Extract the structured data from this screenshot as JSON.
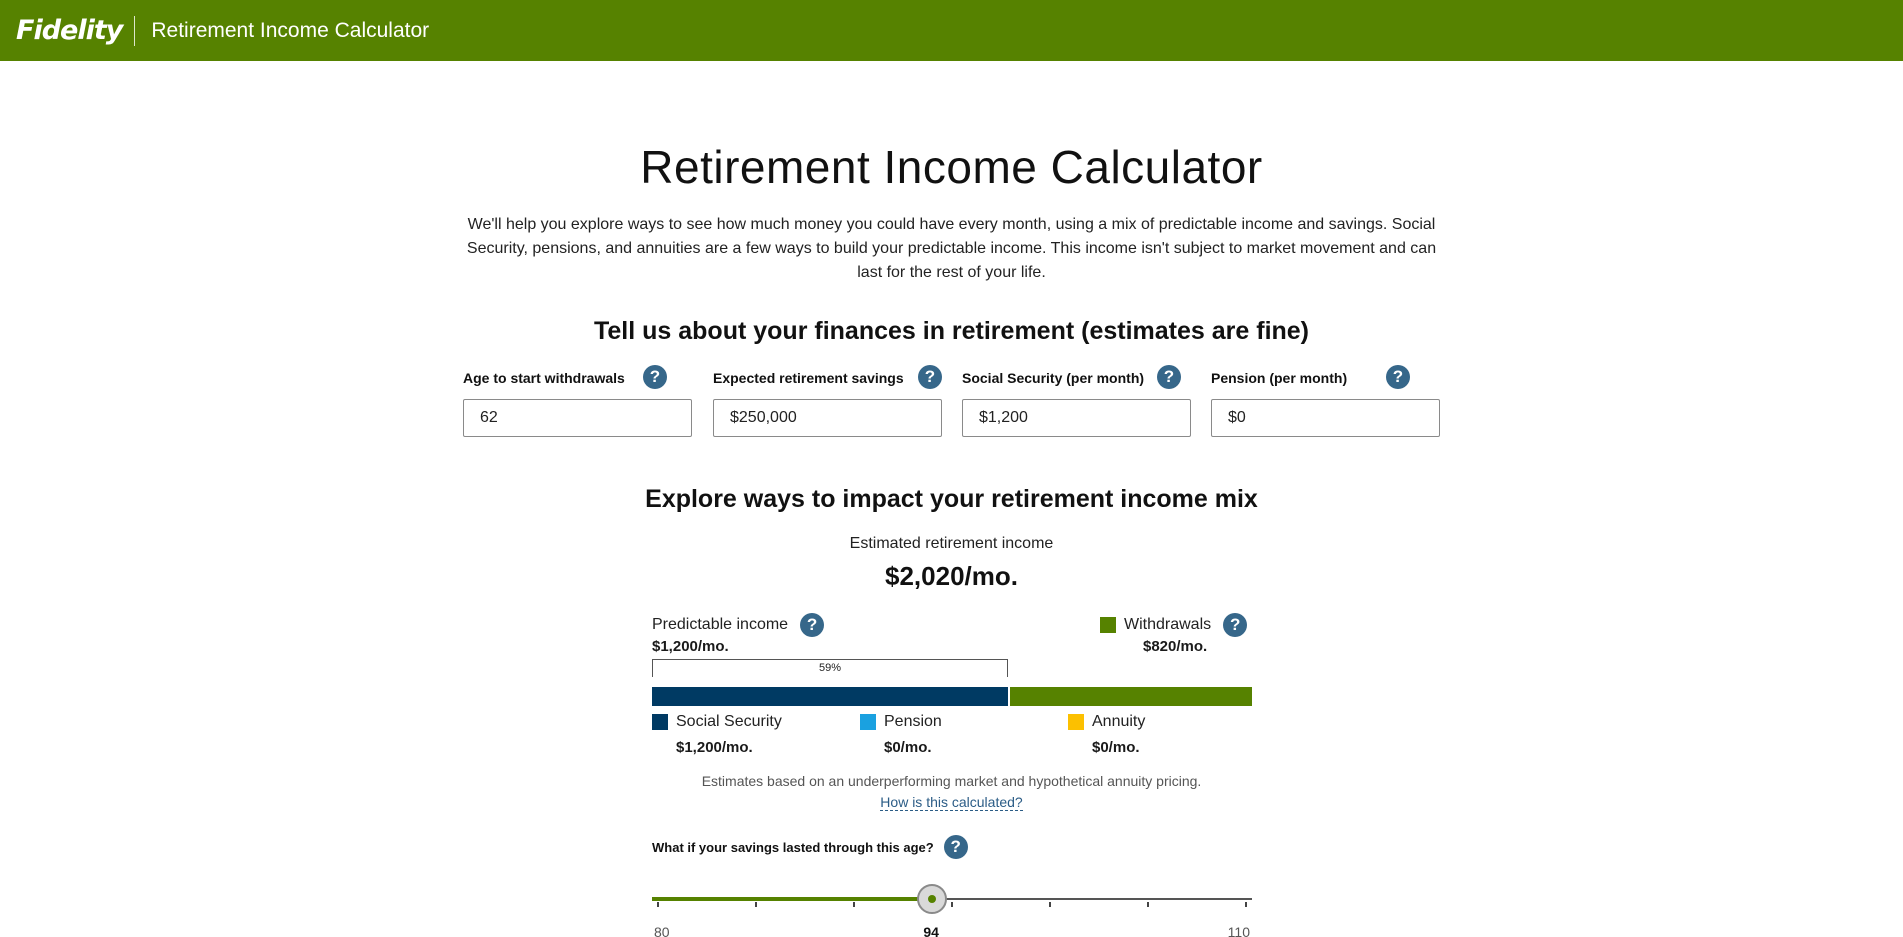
{
  "header": {
    "logo": "Fidelity",
    "app_title": "Retirement Income Calculator"
  },
  "page_title": "Retirement Income Calculator",
  "intro": "We'll help you explore ways to see how much money you could have every month, using a mix of predictable income and savings. Social Security, pensions, and annuities are a few ways to build your predictable income. This income isn't subject to market movement and can last for the rest of your life.",
  "finances": {
    "heading_bold": "Tell us about your finances in retirement",
    "heading_note": "(estimates are fine)",
    "fields": [
      {
        "label": "Age to start withdrawals",
        "value": "62"
      },
      {
        "label": "Expected retirement savings",
        "value": "$250,000"
      },
      {
        "label": "Social Security (per month)",
        "value": "$1,200"
      },
      {
        "label": "Pension (per month)",
        "value": "$0"
      }
    ]
  },
  "explore": {
    "heading": "Explore ways to impact your retirement income mix",
    "estimate_label": "Estimated retirement income",
    "estimate_value": "$2,020/mo.",
    "predictable": {
      "label": "Predictable income",
      "value": "$1,200/mo.",
      "percent_label": "59%"
    },
    "withdrawals": {
      "label": "Withdrawals",
      "value": "$820/mo.",
      "color": "#568200"
    },
    "bar": {
      "predictable_fraction": 0.594,
      "withdrawals_fraction": 0.406,
      "predictable_color": "#003a63"
    },
    "legend": [
      {
        "label": "Social Security",
        "value": "$1,200/mo.",
        "color": "#003a63"
      },
      {
        "label": "Pension",
        "value": "$0/mo.",
        "color": "#1aa1e0"
      },
      {
        "label": "Annuity",
        "value": "$0/mo.",
        "color": "#fcc000"
      }
    ],
    "disclaimer": "Estimates based on an underperforming market and hypothetical annuity pricing.",
    "calc_link": "How is this calculated?",
    "whatif_label": "What if your savings lasted through this age?",
    "slider": {
      "min": 80,
      "max": 110,
      "value": 94,
      "min_label": "80",
      "value_label": "94",
      "max_label": "110",
      "tick_count": 7
    }
  },
  "help_glyph": "?"
}
